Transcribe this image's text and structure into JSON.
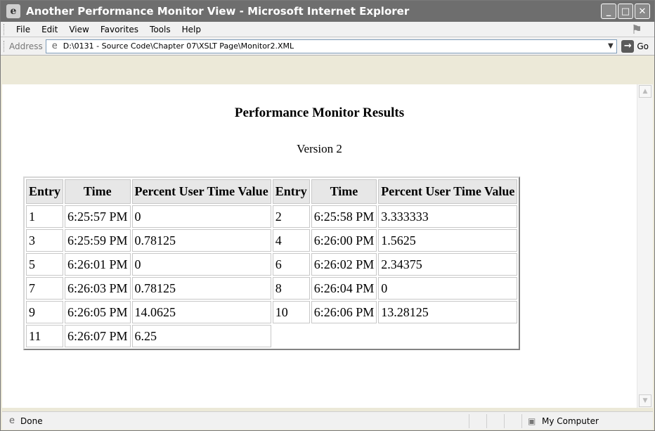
{
  "window": {
    "title": "Another Performance Monitor View - Microsoft Internet Explorer",
    "controls": {
      "minimize": "_",
      "maximize": "□",
      "close": "✕"
    }
  },
  "menu": [
    "File",
    "Edit",
    "View",
    "Favorites",
    "Tools",
    "Help"
  ],
  "address": {
    "label": "Address",
    "value": "D:\\0131 - Source Code\\Chapter 07\\XSLT Page\\Monitor2.XML",
    "go_label": "Go"
  },
  "page": {
    "title": "Performance Monitor Results",
    "subtitle": "Version 2"
  },
  "table": {
    "headers": [
      "Entry",
      "Time",
      "Percent User Time Value",
      "Entry",
      "Time",
      "Percent User Time Value"
    ],
    "rows": [
      [
        "1",
        "6:25:57 PM",
        "0",
        "2",
        "6:25:58 PM",
        "3.333333"
      ],
      [
        "3",
        "6:25:59 PM",
        "0.78125",
        "4",
        "6:26:00 PM",
        "1.5625"
      ],
      [
        "5",
        "6:26:01 PM",
        "0",
        "6",
        "6:26:02 PM",
        "2.34375"
      ],
      [
        "7",
        "6:26:03 PM",
        "0.78125",
        "8",
        "6:26:04 PM",
        "0"
      ],
      [
        "9",
        "6:26:05 PM",
        "14.0625",
        "10",
        "6:26:06 PM",
        "13.28125"
      ],
      [
        "11",
        "6:26:07 PM",
        "6.25"
      ]
    ]
  },
  "status": {
    "text": "Done",
    "zone": "My Computer"
  }
}
